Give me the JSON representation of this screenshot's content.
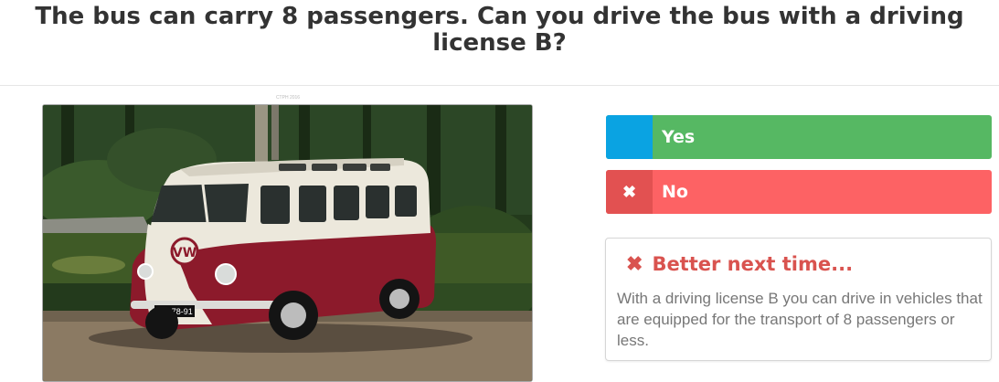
{
  "question": {
    "title": "The bus can carry 8 passengers. Can you drive the bus with a driving license B?"
  },
  "image": {
    "credit": "CTPH 2016",
    "plate": "AM-78-91"
  },
  "answers": [
    {
      "marker": "",
      "label": "Yes",
      "marker_color": "#0aa3e2",
      "bar_color": "#56b863"
    },
    {
      "marker": "✖",
      "label": "No",
      "marker_color": "#e25151",
      "bar_color": "#fd6264"
    }
  ],
  "feedback": {
    "icon": "close-icon",
    "heading": "Better next time...",
    "body": "With a driving license B you can drive in vehicles that are equipped for the transport of 8 passengers or less."
  }
}
